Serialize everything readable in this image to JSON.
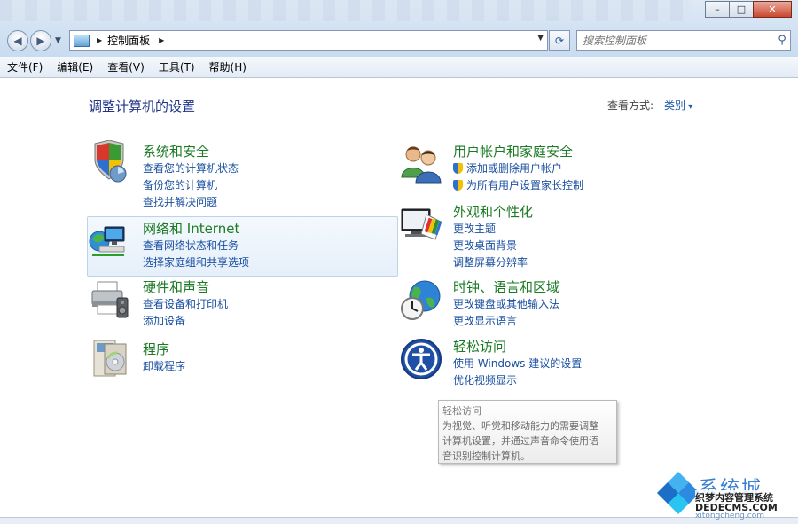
{
  "window": {
    "controls": {
      "minimize": "–",
      "maximize": "□",
      "close": "✕"
    }
  },
  "address": {
    "root_label": "控制面板",
    "search_placeholder": "搜索控制面板"
  },
  "menu": [
    "文件(F)",
    "编辑(E)",
    "查看(V)",
    "工具(T)",
    "帮助(H)"
  ],
  "main": {
    "heading": "调整计算机的设置",
    "view_by_label": "查看方式:",
    "view_by_value": "类别"
  },
  "categories": [
    {
      "title": "系统和安全",
      "links": [
        "查看您的计算机状态",
        "备份您的计算机",
        "查找并解决问题"
      ],
      "icon": "shield-icon"
    },
    {
      "title": "网络和 Internet",
      "links": [
        "查看网络状态和任务",
        "选择家庭组和共享选项"
      ],
      "icon": "network-icon"
    },
    {
      "title": "硬件和声音",
      "links": [
        "查看设备和打印机",
        "添加设备"
      ],
      "icon": "printer-icon"
    },
    {
      "title": "程序",
      "links": [
        "卸载程序"
      ],
      "icon": "programs-icon"
    },
    {
      "title": "用户帐户和家庭安全",
      "links": [
        "添加或删除用户帐户",
        "为所有用户设置家长控制"
      ],
      "icon": "users-icon"
    },
    {
      "title": "外观和个性化",
      "links": [
        "更改主题",
        "更改桌面背景",
        "调整屏幕分辨率"
      ],
      "icon": "monitor-palette-icon"
    },
    {
      "title": "时钟、语言和区域",
      "links": [
        "更改键盘或其他输入法",
        "更改显示语言"
      ],
      "icon": "globe-clock-icon"
    },
    {
      "title": "轻松访问",
      "links": [
        "使用 Windows 建议的设置",
        "优化视频显示"
      ],
      "icon": "accessibility-icon"
    }
  ],
  "tooltip": {
    "title": "轻松访问",
    "lines": [
      "为视觉、听觉和移动能力的需要调整",
      "计算机设置，并通过声音命令使用语",
      "音识别控制计算机。"
    ]
  },
  "watermark": {
    "brand": "系统城",
    "line1": "织梦内容管理系统",
    "line2": "DEDECMS.COM",
    "line3": "xitongcheng.com"
  },
  "colors": {
    "link": "#1a4fa0",
    "category_title": "#1b7a24",
    "heading": "#1e3287"
  }
}
